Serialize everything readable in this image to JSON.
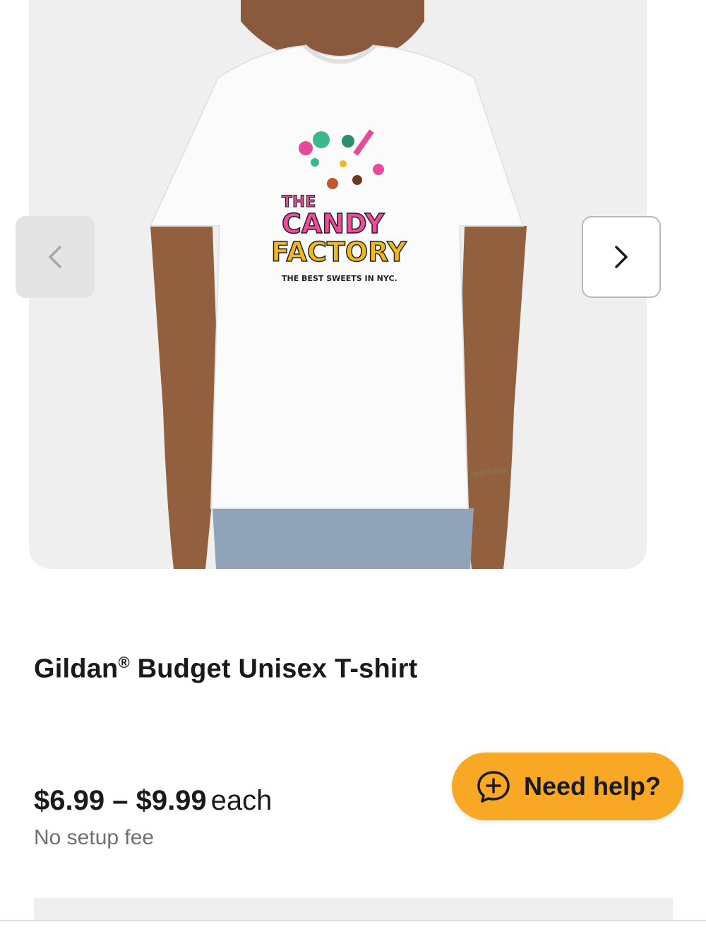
{
  "product": {
    "image_alt": "Model wearing white t-shirt with candy logo",
    "print": {
      "line1": "THE",
      "line2": "CANDY",
      "line3": "FACTORY",
      "tagline": "THE BEST SWEETS IN NYC."
    },
    "title_main": "Gildan",
    "title_reg": "®",
    "title_rest": " Budget Unisex T-shirt",
    "price_range": "$6.99 – $9.99",
    "price_unit": "each",
    "setup_fee": "No setup fee"
  },
  "carousel": {
    "prev_icon": "chevron-left-icon",
    "next_icon": "chevron-right-icon"
  },
  "help": {
    "label": "Need help?",
    "icon": "chat-sparkle-icon",
    "color": "#f9a825"
  }
}
